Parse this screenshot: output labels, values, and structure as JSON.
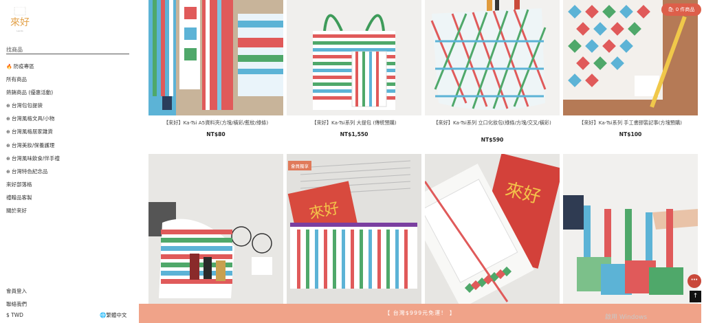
{
  "brand": {
    "logo_text": "來好"
  },
  "search": {
    "placeholder": "找商品"
  },
  "nav": [
    {
      "icon": "🔥",
      "label": "防疫專區"
    },
    {
      "icon": "",
      "label": "所有商品"
    },
    {
      "icon": "",
      "label": "熱銷商品 (優惠活動)"
    },
    {
      "icon": "⊕",
      "label": "台灣包包提袋"
    },
    {
      "icon": "⊕",
      "label": "台灣風格文具/小物"
    },
    {
      "icon": "⊕",
      "label": "台灣風格居家雜貨"
    },
    {
      "icon": "⊕",
      "label": "台灣美妝/保養護理"
    },
    {
      "icon": "⊕",
      "label": "台灣風味飲食/伴手禮"
    },
    {
      "icon": "⊕",
      "label": "台灣特色紀念品"
    },
    {
      "icon": "",
      "label": "來好部落格"
    },
    {
      "icon": "",
      "label": "禮贈品客製"
    },
    {
      "icon": "",
      "label": "關於來好"
    }
  ],
  "footer": {
    "member": "會員登入",
    "contact": "聯絡我們",
    "currency": "$ TWD",
    "language": "繁體中文"
  },
  "cart": {
    "label": "0 件商品"
  },
  "products": [
    {
      "title": "【來好】Ka-Tsi A5資料夾(方塊/橫彩/藍紋/綠條)",
      "price": "NT$80",
      "badge": ""
    },
    {
      "title": "【來好】Ka-Tsi系列 大提包 (傳統預購)",
      "price": "NT$1,550",
      "badge": ""
    },
    {
      "title": "【來好】Ka-Tsi系列 立口化妝包(綠條/方塊/交叉/橫彩)",
      "price": "NT$590",
      "badge": ""
    },
    {
      "title": "【來好】Ka-Tsi系列 手工書膠裝記事(方塊預購)",
      "price": "NT$100",
      "badge": ""
    },
    {
      "title": "",
      "price": "",
      "badge": ""
    },
    {
      "title": "",
      "price": "",
      "badge": "會員獨享"
    },
    {
      "title": "",
      "price": "",
      "badge": ""
    },
    {
      "title": "",
      "price": "",
      "badge": ""
    }
  ],
  "promo": {
    "text": "【 台灣$999元免運！ 】"
  },
  "watermark": {
    "text": "啟用 Windows"
  },
  "colors": {
    "accent": "#dd5f4a",
    "promo_bar": "#f0a389"
  }
}
